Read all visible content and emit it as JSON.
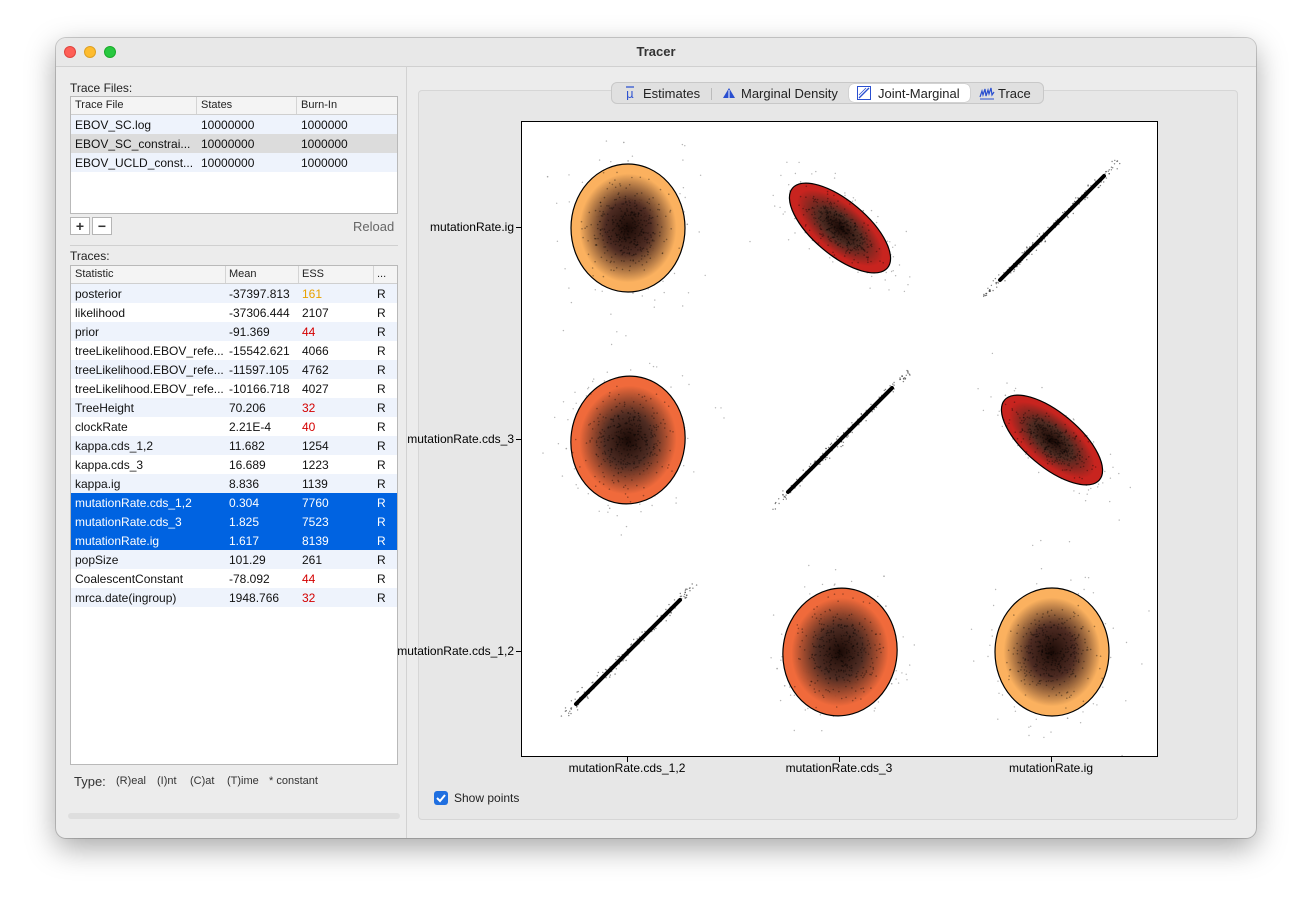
{
  "window": {
    "title": "Tracer"
  },
  "trace_files": {
    "label": "Trace Files:",
    "columns": [
      "Trace File",
      "States",
      "Burn-In"
    ],
    "rows": [
      [
        "EBOV_SC.log",
        "10000000",
        "1000000"
      ],
      [
        "EBOV_SC_constrai...",
        "10000000",
        "1000000"
      ],
      [
        "EBOV_UCLD_const...",
        "10000000",
        "1000000"
      ]
    ],
    "add_label": "+",
    "remove_label": "−",
    "reload_label": "Reload"
  },
  "traces": {
    "label": "Traces:",
    "columns": [
      "Statistic",
      "Mean",
      "ESS",
      "..."
    ],
    "rows": [
      {
        "stat": "posterior",
        "mean": "-37397.813",
        "ess": "161",
        "type": "R",
        "ess_color": "#e8a100"
      },
      {
        "stat": "likelihood",
        "mean": "-37306.444",
        "ess": "2107",
        "type": "R",
        "ess_color": ""
      },
      {
        "stat": "prior",
        "mean": "-91.369",
        "ess": "44",
        "type": "R",
        "ess_color": "#d40000"
      },
      {
        "stat": "treeLikelihood.EBOV_refe...",
        "mean": "-15542.621",
        "ess": "4066",
        "type": "R",
        "ess_color": ""
      },
      {
        "stat": "treeLikelihood.EBOV_refe...",
        "mean": "-11597.105",
        "ess": "4762",
        "type": "R",
        "ess_color": ""
      },
      {
        "stat": "treeLikelihood.EBOV_refe...",
        "mean": "-10166.718",
        "ess": "4027",
        "type": "R",
        "ess_color": ""
      },
      {
        "stat": "TreeHeight",
        "mean": "70.206",
        "ess": "32",
        "type": "R",
        "ess_color": "#d40000"
      },
      {
        "stat": "clockRate",
        "mean": "2.21E-4",
        "ess": "40",
        "type": "R",
        "ess_color": "#d40000"
      },
      {
        "stat": "kappa.cds_1,2",
        "mean": "11.682",
        "ess": "1254",
        "type": "R",
        "ess_color": ""
      },
      {
        "stat": "kappa.cds_3",
        "mean": "16.689",
        "ess": "1223",
        "type": "R",
        "ess_color": ""
      },
      {
        "stat": "kappa.ig",
        "mean": "8.836",
        "ess": "1139",
        "type": "R",
        "ess_color": ""
      },
      {
        "stat": "mutationRate.cds_1,2",
        "mean": "0.304",
        "ess": "7760",
        "type": "R",
        "ess_color": "",
        "selected": true
      },
      {
        "stat": "mutationRate.cds_3",
        "mean": "1.825",
        "ess": "7523",
        "type": "R",
        "ess_color": "",
        "selected": true
      },
      {
        "stat": "mutationRate.ig",
        "mean": "1.617",
        "ess": "8139",
        "type": "R",
        "ess_color": "",
        "selected": true
      },
      {
        "stat": "popSize",
        "mean": "101.29",
        "ess": "261",
        "type": "R",
        "ess_color": ""
      },
      {
        "stat": "CoalescentConstant",
        "mean": "-78.092",
        "ess": "44",
        "type": "R",
        "ess_color": "#d40000"
      },
      {
        "stat": "mrca.date(ingroup)",
        "mean": "1948.766",
        "ess": "32",
        "type": "R",
        "ess_color": "#d40000"
      }
    ]
  },
  "type_legend": {
    "label": "Type:",
    "items": [
      "(R)eal",
      "(I)nt",
      "(C)at",
      "(T)ime",
      "* constant"
    ]
  },
  "tabs": [
    {
      "label": "Estimates",
      "icon": "mu-icon",
      "active": false
    },
    {
      "label": "Marginal Density",
      "icon": "density-icon",
      "active": false
    },
    {
      "label": "Joint-Marginal",
      "icon": "joint-icon",
      "active": true
    },
    {
      "label": "Trace",
      "icon": "trace-icon",
      "active": false
    }
  ],
  "show_points": {
    "label": "Show points",
    "checked": true
  },
  "chart_data": {
    "type": "scatter",
    "title": "",
    "variables": [
      "mutationRate.cds_1,2",
      "mutationRate.cds_3",
      "mutationRate.ig"
    ],
    "x_labels": [
      "mutationRate.cds_1,2",
      "mutationRate.cds_3",
      "mutationRate.ig"
    ],
    "y_labels": [
      "mutationRate.ig",
      "mutationRate.cds_3",
      "mutationRate.cds_1,2"
    ],
    "cells": [
      {
        "row": 0,
        "col": 0,
        "kind": "ellipse",
        "fill": "#fbb15f",
        "corr": 0.0
      },
      {
        "row": 0,
        "col": 1,
        "kind": "ellipse",
        "fill": "#c8241f",
        "corr": -0.7
      },
      {
        "row": 0,
        "col": 2,
        "kind": "diagonal",
        "corr": 1.0
      },
      {
        "row": 1,
        "col": 0,
        "kind": "ellipse",
        "fill": "#f06a3b",
        "corr": -0.1
      },
      {
        "row": 1,
        "col": 1,
        "kind": "diagonal",
        "corr": 1.0
      },
      {
        "row": 1,
        "col": 2,
        "kind": "ellipse",
        "fill": "#c8241f",
        "corr": -0.7
      },
      {
        "row": 2,
        "col": 0,
        "kind": "diagonal",
        "corr": 1.0
      },
      {
        "row": 2,
        "col": 1,
        "kind": "ellipse",
        "fill": "#f06a3b",
        "corr": -0.1
      },
      {
        "row": 2,
        "col": 2,
        "kind": "ellipse",
        "fill": "#fbb15f",
        "corr": 0.0
      }
    ]
  }
}
